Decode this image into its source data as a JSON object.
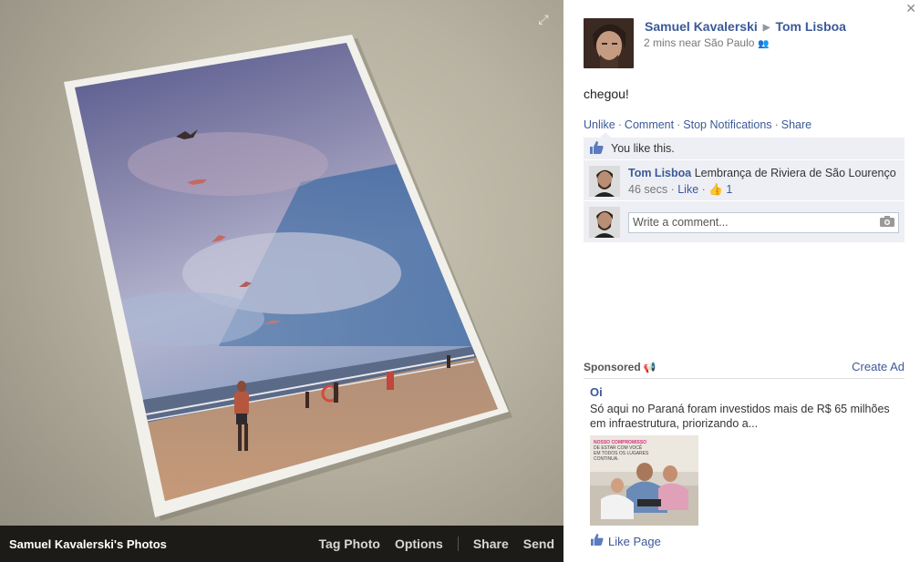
{
  "photo_bar": {
    "album_title": "Samuel Kavalerski's Photos",
    "tag_photo": "Tag Photo",
    "options": "Options",
    "share": "Share",
    "send": "Send"
  },
  "post": {
    "author": "Samuel Kavalerski",
    "recipient": "Tom Lisboa",
    "time_location": "2 mins near São Paulo",
    "message": "chegou!",
    "actions": {
      "unlike": "Unlike",
      "comment": "Comment",
      "stop_notifications": "Stop Notifications",
      "share": "Share"
    },
    "likes_text": "You like this.",
    "comments": [
      {
        "author": "Tom Lisboa",
        "text": "Lembrança de Riviera de São Lourenço",
        "time": "46 secs",
        "like_label": "Like",
        "like_count": "1"
      }
    ],
    "compose_placeholder": "Write a comment..."
  },
  "sponsored": {
    "label": "Sponsored",
    "create_ad": "Create Ad",
    "ad_title": "Oi",
    "ad_text": "Só aqui no Paraná foram investidos mais de R$ 65 milhões em infraestrutura, priorizando a...",
    "ad_image_caption": "NOSSO COMPROMISSO DE ESTAR COM VOCÊ EM TODOS OS LUGARES CONTINUA.",
    "like_page": "Like Page"
  },
  "icons": {
    "close": "close-icon",
    "expand": "expand-icon",
    "people": "people-icon",
    "thumbs_up": "thumbs-up-icon",
    "camera": "camera-icon",
    "megaphone": "megaphone-icon"
  },
  "colors": {
    "link": "#3b5998",
    "ufi_bg": "#edeff4",
    "photo_bar_bg": "#1d1b18"
  }
}
